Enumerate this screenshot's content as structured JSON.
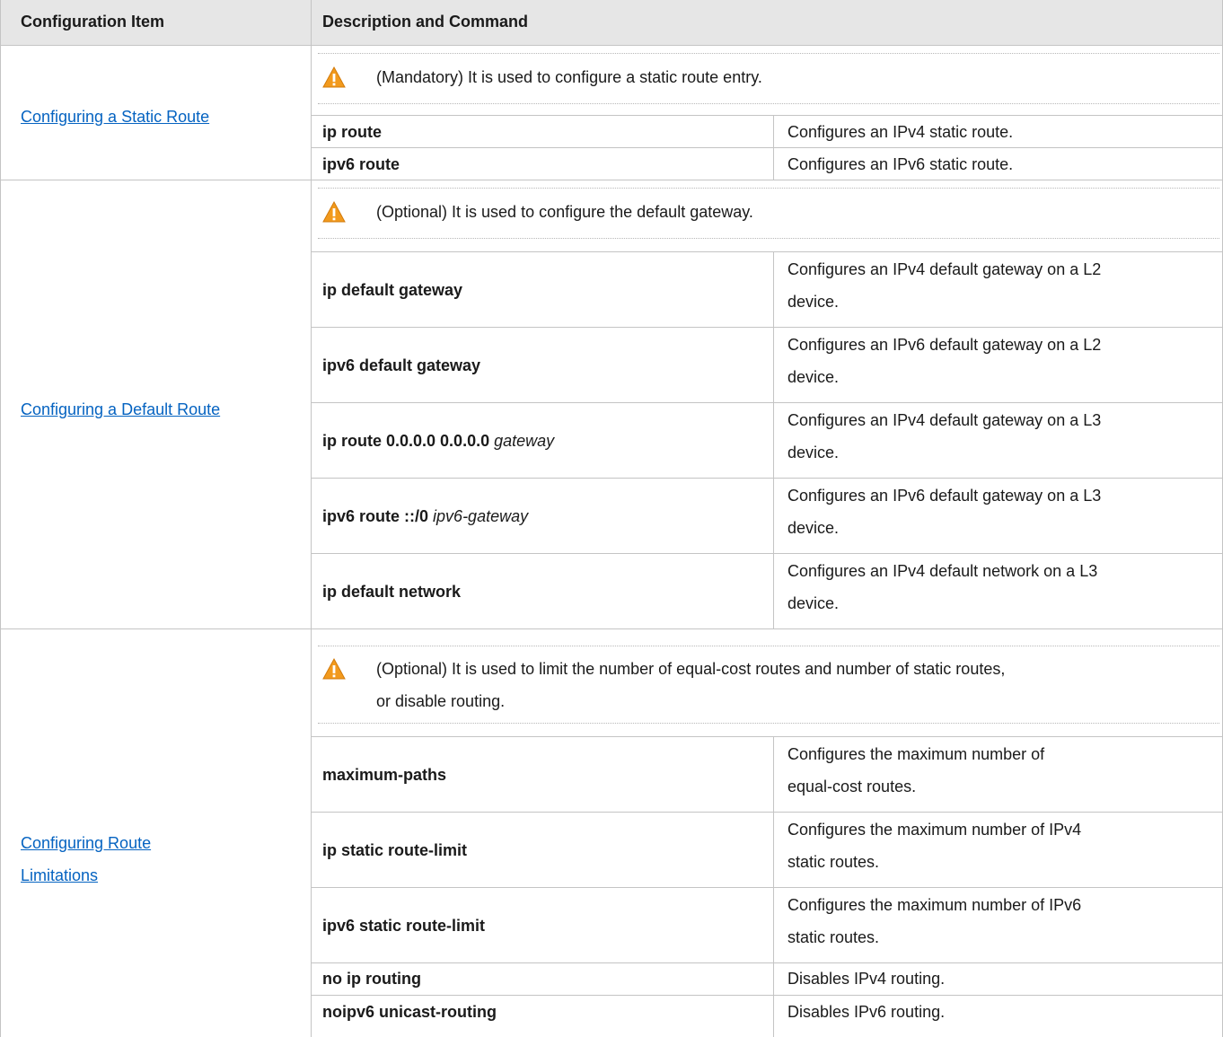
{
  "header": {
    "col1": "Configuration Item",
    "col2": "Description and Command"
  },
  "sections": {
    "static": {
      "link": "Configuring a Static Route",
      "note": "(Mandatory) It is used to configure a static route entry.",
      "rows": [
        {
          "cmd": "ip route",
          "desc": "Configures an IPv4 static route."
        },
        {
          "cmd": "ipv6 route",
          "desc": "Configures an IPv6 static route."
        }
      ]
    },
    "default": {
      "link": "Configuring a Default Route",
      "note": "(Optional) It is used to configure the default gateway.",
      "rows": [
        {
          "cmd": "ip default gateway",
          "desc1": "Configures an IPv4 default gateway on a L2",
          "desc2": "device."
        },
        {
          "cmd": "ipv6 default gateway",
          "desc1": "Configures an IPv6 default gateway on a L2",
          "desc2": "device."
        },
        {
          "cmd": "ip route 0.0.0.0 0.0.0.0",
          "arg": "gateway",
          "desc1": "Configures an IPv4 default gateway on a L3",
          "desc2": "device."
        },
        {
          "cmd": "ipv6 route ::/0",
          "arg": "ipv6-gateway",
          "desc1": "Configures an IPv6 default gateway on a L3",
          "desc2": "device."
        },
        {
          "cmd": "ip default network",
          "desc1": "Configures an IPv4 default network on a L3",
          "desc2": "device."
        }
      ]
    },
    "limits": {
      "link1": "Configuring Route",
      "link2": "Limitations",
      "note1": "(Optional) It is used to limit the number of equal-cost routes and number of static routes,",
      "note2": "or disable routing.",
      "rows": [
        {
          "cmd": "maximum-paths",
          "desc1": "Configures the maximum number of",
          "desc2": "equal-cost routes."
        },
        {
          "cmd": "ip static route-limit",
          "desc1": "Configures the maximum number of IPv4",
          "desc2": "static routes."
        },
        {
          "cmd": "ipv6 static route-limit",
          "desc1": "Configures the maximum number of IPv6",
          "desc2": "static routes."
        },
        {
          "cmd": "no ip routing",
          "desc": "Disables IPv4 routing."
        },
        {
          "cmd": "noipv6 unicast-routing",
          "desc": "Disables IPv6 routing."
        }
      ]
    }
  }
}
